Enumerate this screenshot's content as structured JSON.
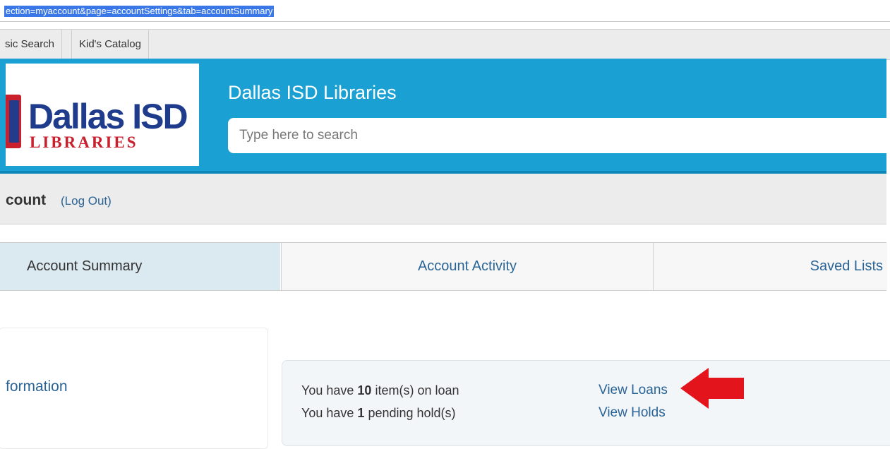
{
  "browser": {
    "url_selected": "ection=myaccount&page=accountSettings&tab=accountSummary"
  },
  "catalog_tabs": [
    "sic Search",
    "Kid's Catalog"
  ],
  "header": {
    "logo": {
      "line1": "Dallas ISD",
      "line2": "LIBRARIES"
    },
    "site_title": "Dallas ISD Libraries",
    "search_placeholder": "Type here to search"
  },
  "account": {
    "title": "count",
    "logout": "(Log Out)"
  },
  "tabs": [
    {
      "label": "Account Summary",
      "active": true
    },
    {
      "label": "Account Activity",
      "active": false
    },
    {
      "label": "Saved Lists",
      "active": false
    }
  ],
  "left_panel": {
    "title": "formation"
  },
  "summary": {
    "loan_prefix": "You have ",
    "loan_count": "10",
    "loan_suffix": " item(s) on loan",
    "hold_prefix": "You have ",
    "hold_count": "1",
    "hold_suffix": " pending hold(s)",
    "view_loans": "View Loans",
    "view_holds": "View Holds"
  },
  "colors": {
    "header_blue": "#1aa0d2",
    "link_blue": "#2a6496",
    "annotation_red": "#e3141b",
    "active_tab": "#dbe9f0"
  },
  "icons": [
    "red-arrow-icon"
  ]
}
